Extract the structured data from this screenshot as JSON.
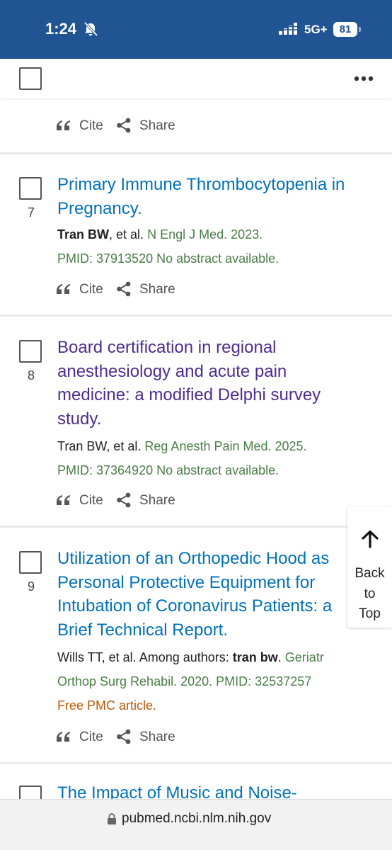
{
  "status_bar": {
    "time": "1:24",
    "network": "5G+",
    "battery": "81",
    "icons": [
      "bell-slash-icon",
      "signal-icon"
    ]
  },
  "toolbar": {
    "more_icon": "ellipsis-icon"
  },
  "actions": {
    "cite": "Cite",
    "share": "Share"
  },
  "results": [
    {
      "rank": "7",
      "title": "Primary Immune Thrombocytopenia in Pregnancy.",
      "title_lines": [
        "Primary Immune Thrombocytopenia in",
        "Pregnancy."
      ],
      "visited": false,
      "authors": "Tran BW",
      "etal": ", et al.",
      "journal": "N Engl J Med. 2023.",
      "pmid": "PMID: 37913520 No abstract available."
    },
    {
      "rank": "8",
      "title": "Board certification in regional anesthesiology and acute pain medicine: a modified Delphi survey study.",
      "title_lines": [
        "Board certification in regional",
        "anesthesiology and acute pain",
        "medicine: a modified Delphi survey",
        "study."
      ],
      "visited": true,
      "authors": "Tran BW",
      "etal": ", et al.",
      "journal": "Reg Anesth Pain Med. 2025.",
      "pmid": "PMID: 37364920 No abstract available."
    },
    {
      "rank": "9",
      "title": "Utilization of an Orthopedic Hood as Personal Protective Equipment for Intubation of Coronavirus Patients: a Brief Technical Report.",
      "title_lines": [
        "Utilization of an Orthopedic Hood as",
        "Personal Protective Equipment for",
        "Intubation of Coronavirus Patients: a",
        "Brief Technical Report."
      ],
      "visited": false,
      "authors_prefix": "Wills TT, et al. Among authors: ",
      "authors_match": "tran bw",
      "journal_line1": "Geriatr",
      "journal_line2": "Orthop Surg Rehabil. 2020.",
      "pmid": "PMID: 32537257",
      "free_pmc": "Free PMC article."
    },
    {
      "title_partial": "The Impact of Music and Noise-"
    }
  ],
  "back_to_top": {
    "lines": [
      "Back",
      "to",
      "Top"
    ]
  },
  "url_bar": {
    "url": "pubmed.ncbi.nlm.nih.gov"
  },
  "colors": {
    "header": "#205493",
    "link": "#0071bc",
    "visited_link": "#4c2c92",
    "journal": "#4a7e46",
    "free_article": "#c05600",
    "background": "#ebebeb"
  }
}
